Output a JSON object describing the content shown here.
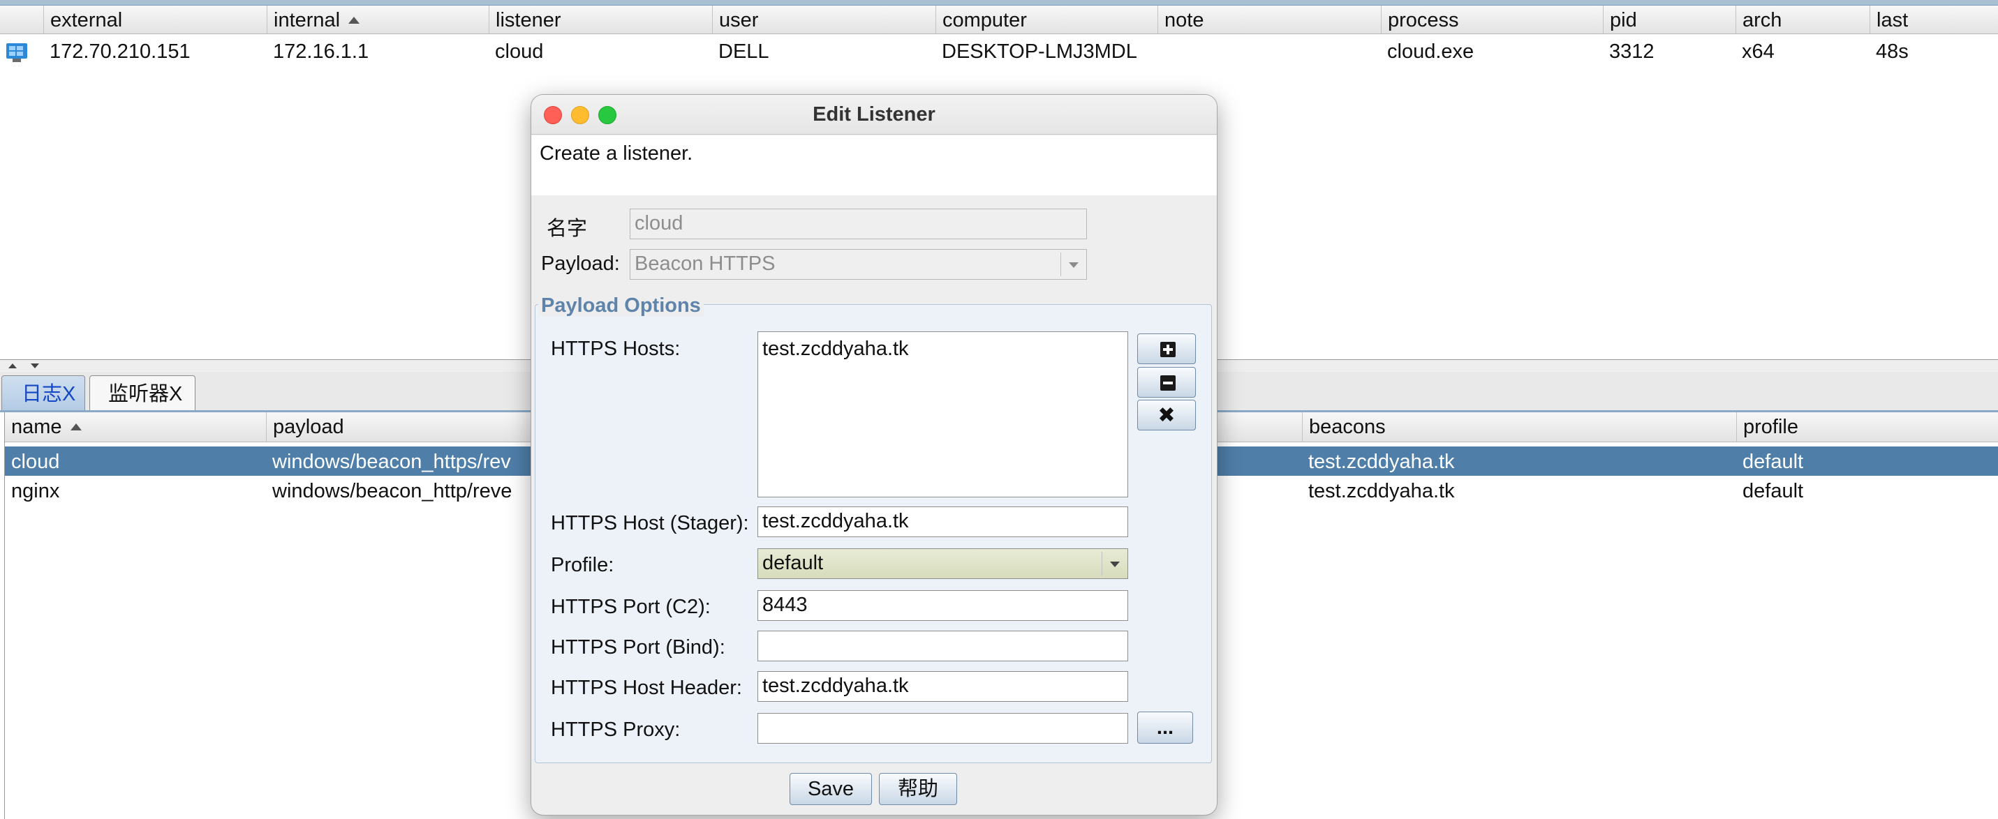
{
  "beacons_table": {
    "columns": [
      "external",
      "internal",
      "listener",
      "user",
      "computer",
      "note",
      "process",
      "pid",
      "arch",
      "last"
    ],
    "rows": [
      {
        "icon": "windows-computer-icon",
        "external": "172.70.210.151",
        "internal": "172.16.1.1",
        "listener": "cloud",
        "user": "DELL",
        "computer": "DESKTOP-LMJ3MDL",
        "note": "",
        "process": "cloud.exe",
        "pid": "3312",
        "arch": "x64",
        "last": "48s"
      }
    ]
  },
  "tabs": [
    {
      "label": "日志X"
    },
    {
      "label": "监听器X"
    }
  ],
  "listeners_table": {
    "columns": [
      "name",
      "payload",
      "beacons",
      "profile"
    ],
    "rows": [
      {
        "name": "cloud",
        "payload": "windows/beacon_https/rev",
        "beacons": "test.zcddyaha.tk",
        "profile": "default",
        "selected": true
      },
      {
        "name": "nginx",
        "payload": "windows/beacon_http/reve",
        "beacons": "test.zcddyaha.tk",
        "profile": "default",
        "selected": false
      }
    ]
  },
  "dialog": {
    "title": "Edit Listener",
    "description": "Create a listener.",
    "name_label": "名字",
    "name_value": "cloud",
    "payload_label": "Payload:",
    "payload_value": "Beacon HTTPS",
    "group_title": "Payload Options",
    "hosts_label": "HTTPS Hosts:",
    "hosts": [
      "test.zcddyaha.tk"
    ],
    "add_host_icon": "plus-square-icon",
    "remove_host_icon": "minus-square-icon",
    "clear_hosts_icon": "close-x-icon",
    "stager_label": "HTTPS Host (Stager):",
    "stager_value": "test.zcddyaha.tk",
    "profile_label": "Profile:",
    "profile_value": "default",
    "port_c2_label": "HTTPS Port (C2):",
    "port_c2_value": "8443",
    "port_bind_label": "HTTPS Port (Bind):",
    "port_bind_value": "",
    "host_header_label": "HTTPS Host Header:",
    "host_header_value": "test.zcddyaha.tk",
    "proxy_label": "HTTPS Proxy:",
    "proxy_value": "",
    "proxy_button": "...",
    "save_label": "Save",
    "help_label": "帮助"
  },
  "colors": {
    "selection": "#4f7ea8",
    "group_title": "#5f84ab",
    "active_tab_text": "#1447c4"
  }
}
